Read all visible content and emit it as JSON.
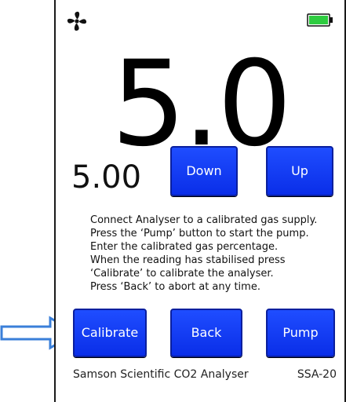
{
  "status_bar": {
    "fan_icon": "fan-icon",
    "battery_icon": "battery-icon",
    "battery_color": "#2ecc40"
  },
  "reading": {
    "current": "5.0",
    "set_value": "5.00"
  },
  "buttons": {
    "down": "Down",
    "up": "Up",
    "calibrate": "Calibrate",
    "back": "Back",
    "pump": "Pump"
  },
  "instructions": [
    "Connect Analyser to a calibrated gas supply.",
    "Press the ‘Pump’ button to start the pump.",
    "Enter the calibrated gas percentage.",
    "When the reading has stabilised press",
    "‘Calibrate’ to calibrate the analyser.",
    "Press ‘Back’ to abort at any time."
  ],
  "footer": {
    "name": "Samson Scientific CO2 Analyser",
    "model": "SSA-20"
  },
  "colors": {
    "button_blue": "#0a2ee8",
    "arrow_outline": "#3a7fd9"
  }
}
